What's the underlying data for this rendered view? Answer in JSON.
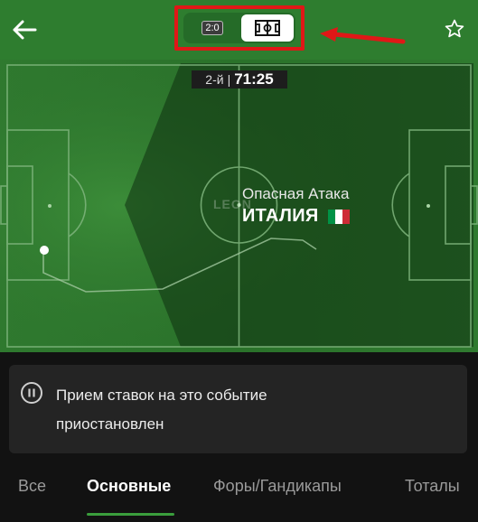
{
  "header": {
    "score_label": "2:0",
    "back_icon": "arrow-left-icon",
    "favorite_icon": "star-outline-icon",
    "field_view_icon": "football-field-icon"
  },
  "match": {
    "period": "2-й",
    "separator": "|",
    "clock": "71:25",
    "event_label": "Опасная Атака",
    "team": "ИТАЛИЯ",
    "watermark": "LEON",
    "flag_colors": [
      "#009246",
      "#ffffff",
      "#ce2b37"
    ]
  },
  "notice": {
    "icon": "pause-icon",
    "text": "Прием ставок на это событие приостановлен"
  },
  "tabs": [
    {
      "label": "Все",
      "active": false
    },
    {
      "label": "Основные",
      "active": true
    },
    {
      "label": "Форы/Гандикапы",
      "active": false
    },
    {
      "label": "Тоталы",
      "active": false
    }
  ],
  "colors": {
    "header_bg": "#2e7d2f",
    "highlight": "#e01717",
    "accent": "#3a9e3c"
  }
}
